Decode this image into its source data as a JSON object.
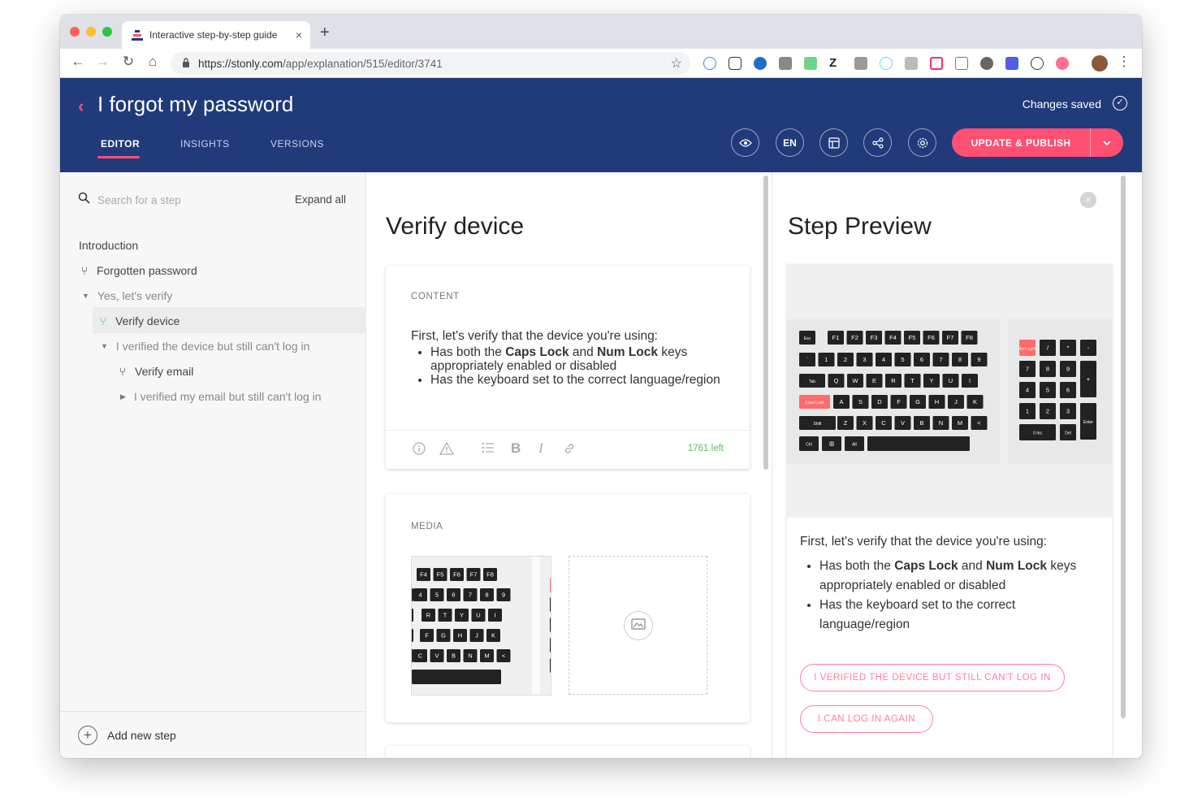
{
  "browser": {
    "tab_title": "Interactive step-by-step guide",
    "tab_close": "×",
    "new_tab": "+",
    "url_host": "https://stonly.com",
    "url_path": "/app/explanation/515/editor/3741",
    "back": "←",
    "forward": "→",
    "reload": "↻",
    "home": "⌂",
    "star": "☆",
    "menu": "⋮",
    "extension_letter": "Z",
    "colors": {
      "red": "#ff5f57",
      "yellow": "#febc2e",
      "green": "#28c840"
    }
  },
  "header": {
    "back_chevron": "‹",
    "title": "I forgot my password",
    "saved_text": "Changes saved",
    "saved_check": "✓",
    "tabs": [
      {
        "label": "EDITOR"
      },
      {
        "label": "INSIGHTS"
      },
      {
        "label": "VERSIONS"
      }
    ],
    "language": "EN",
    "publish_label": "UPDATE & PUBLISH",
    "publish_chevron": "⌄",
    "colors": {
      "bg": "#203a7a",
      "accent": "#ff4f73"
    }
  },
  "sidebar": {
    "search_placeholder": "Search for a step",
    "expand_all": "Expand all",
    "items": [
      {
        "label": "Introduction"
      },
      {
        "label": "Forgotten password"
      },
      {
        "label": "Yes, let's verify"
      },
      {
        "label": "Verify device"
      },
      {
        "label": "I verified the device but still can't log in"
      },
      {
        "label": "Verify email"
      },
      {
        "label": "I verified my email but still can't log in"
      }
    ],
    "add_step": "Add new step"
  },
  "editor": {
    "heading": "Verify device",
    "content_label": "CONTENT",
    "intro": "First, let's verify that the device you're using:",
    "bullet1_pre": "Has both the ",
    "bullet1_b1": "Caps Lock",
    "bullet1_mid": " and ",
    "bullet1_b2": "Num Lock",
    "bullet1_post": " keys appropriately enabled or disabled",
    "bullet2": "Has the keyboard set to the correct language/region",
    "chars_left": "1761 left",
    "media_label": "MEDIA"
  },
  "preview": {
    "heading": "Step Preview",
    "close": "×",
    "intro": "First, let's verify that the device you're using:",
    "bullet1_pre": "Has both the ",
    "bullet1_b1": "Caps Lock",
    "bullet1_mid": " and ",
    "bullet1_b2": "Num Lock",
    "bullet1_post": " keys appropriately enabled or disabled",
    "bullet2": "Has the keyboard set to the correct language/region",
    "choice1": "I VERIFIED THE DEVICE BUT STILL CAN'T LOG IN",
    "choice2": "I CAN LOG IN AGAIN"
  },
  "keyboard": {
    "fn_row": [
      "Esc",
      "F1",
      "F2",
      "F3",
      "F4",
      "F5",
      "F6",
      "F7",
      "F8"
    ],
    "num_row": [
      "`",
      "1",
      "2",
      "3",
      "4",
      "5",
      "6",
      "7",
      "8",
      "9"
    ],
    "q_row": [
      "Tab",
      "Q",
      "W",
      "E",
      "R",
      "T",
      "Y",
      "U",
      "I"
    ],
    "a_row": [
      "Caps Lock",
      "A",
      "S",
      "D",
      "F",
      "G",
      "H",
      "J",
      "K"
    ],
    "z_row": [
      "Shift",
      "Z",
      "X",
      "C",
      "V",
      "B",
      "N",
      "M",
      "<"
    ],
    "bottom_row": [
      "Ctrl",
      "⊞",
      "Alt",
      ""
    ],
    "numpad": [
      "Num Lock",
      "/",
      "*",
      "-",
      "7",
      "8",
      "9",
      "+",
      "4",
      "5",
      "6",
      "",
      "1",
      "2",
      "3",
      "Enter",
      "0 Ins",
      "Del"
    ],
    "media_rows": [
      [
        "F4",
        "F5",
        "F6",
        "F7",
        "F8"
      ],
      [
        "4",
        "5",
        "6",
        "7",
        "8",
        "9"
      ],
      [
        "R",
        "T",
        "Y",
        "U",
        "I"
      ],
      [
        "F",
        "G",
        "H",
        "J",
        "K"
      ],
      [
        "C",
        "V",
        "B",
        "N",
        "M",
        "<"
      ]
    ],
    "highlight": "#ff6b6b"
  }
}
